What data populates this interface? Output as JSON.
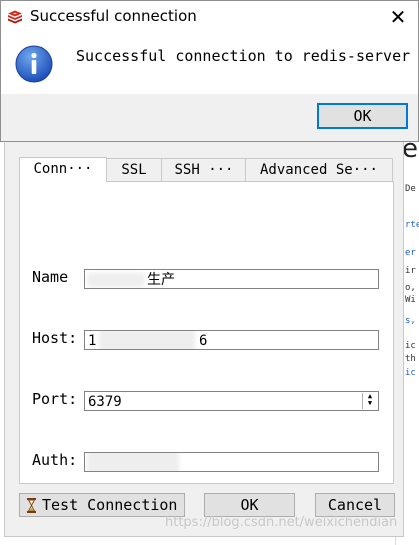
{
  "message_box": {
    "title": "Successful connection",
    "message": "Successful connection to redis-server",
    "ok_label": "OK",
    "close_glyph": "✕",
    "icon": "info-icon",
    "app_icon": "redis-logo-icon",
    "accent": "#0078d7"
  },
  "connection_dialog": {
    "tabs": [
      "Conn···",
      "SSL",
      "SSH ···",
      "Advanced Se···"
    ],
    "fields": {
      "name_label": "Name",
      "name_value": "生产",
      "host_label": "Host:",
      "host_value_start": "1",
      "host_value_end": "6",
      "port_label": "Port:",
      "port_value": "6379",
      "auth_label": "Auth:"
    },
    "buttons": {
      "test_connection": "Test Connection",
      "ok": "OK",
      "cancel": "Cancel"
    }
  },
  "background_window": {
    "large_letter": "e",
    "fragments": [
      "De",
      "rte",
      "er",
      "ir",
      "o,",
      "Wi",
      "s,",
      "ic",
      "th",
      "ic"
    ]
  },
  "watermark": "https://blog.csdn.net/weixichendian"
}
